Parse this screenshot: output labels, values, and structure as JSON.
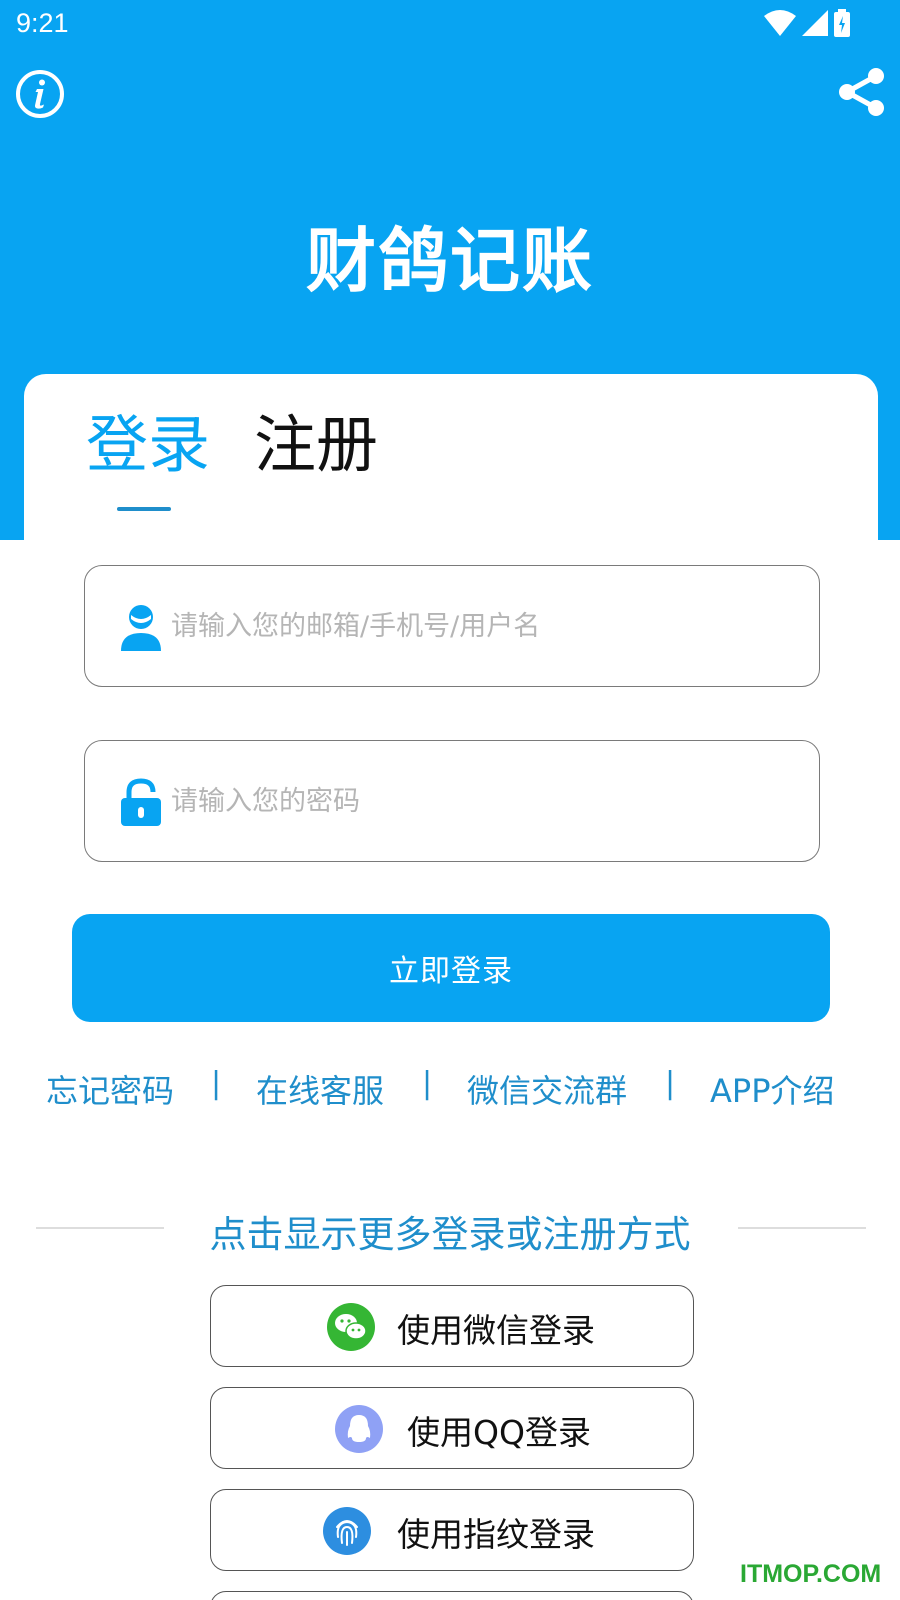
{
  "status_bar": {
    "time": "9:21"
  },
  "header": {
    "app_title": "财鸽记账"
  },
  "tabs": [
    {
      "label": "登录"
    },
    {
      "label": "注册"
    }
  ],
  "form": {
    "username_placeholder": "请输入您的邮箱/手机号/用户名",
    "password_placeholder": "请输入您的密码",
    "submit_label": "立即登录"
  },
  "links": [
    {
      "label": "忘记密码"
    },
    {
      "label": "在线客服"
    },
    {
      "label": "微信交流群"
    },
    {
      "label": "APP介绍"
    }
  ],
  "separator": "|",
  "more_methods_label": "点击显示更多登录或注册方式",
  "social_logins": [
    {
      "label": "使用微信登录",
      "icon": "wechat-icon"
    },
    {
      "label": "使用QQ登录",
      "icon": "qq-icon"
    },
    {
      "label": "使用指纹登录",
      "icon": "fingerprint-icon"
    }
  ],
  "watermark": "ITMOP.COM",
  "colors": {
    "primary": "#08a4f2",
    "link": "#1f8ecb",
    "wechat": "#35b634",
    "qq": "#8fa1f5",
    "fingerprint": "#2d8ee0"
  }
}
